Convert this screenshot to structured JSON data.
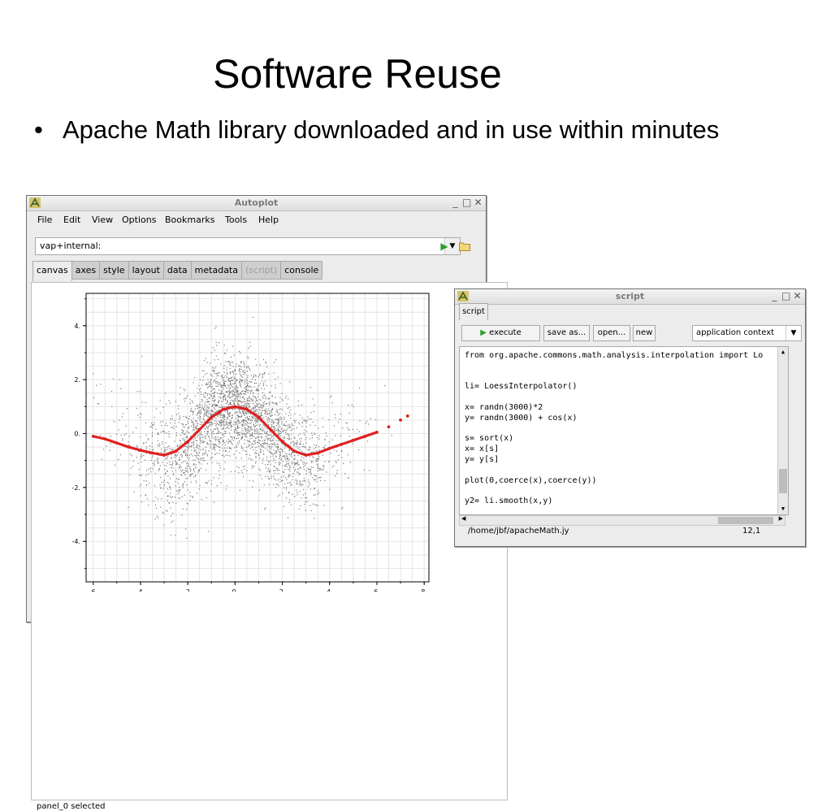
{
  "slide": {
    "title": "Software Reuse",
    "bullet_char": "•",
    "bullet_text": "Apache Math library downloaded and in use within minutes"
  },
  "autoplot": {
    "window_title": "Autoplot",
    "menu": [
      "File",
      "Edit",
      "View",
      "Options",
      "Bookmarks",
      "Tools",
      "Help"
    ],
    "url_value": "vap+internal:",
    "tabs": [
      {
        "label": "canvas",
        "active": true
      },
      {
        "label": "axes"
      },
      {
        "label": "style"
      },
      {
        "label": "layout"
      },
      {
        "label": "data"
      },
      {
        "label": "metadata"
      },
      {
        "label": "(script)",
        "disabled": true
      },
      {
        "label": "console"
      }
    ],
    "status": "panel_0 selected",
    "colors": {
      "smooth_curve": "#e02020",
      "scatter": "#555555",
      "play": "#2f9e2f",
      "folder": "#e8c04a"
    }
  },
  "chart_data": {
    "type": "scatter",
    "title": "",
    "xlabel": "",
    "ylabel": "",
    "xlim": [
      -6.3,
      8.2
    ],
    "ylim": [
      -5.5,
      5.2
    ],
    "x_ticks": [
      "-6.",
      "-4.",
      "-2.",
      "0.",
      "2.",
      "4.",
      "6.",
      "8."
    ],
    "y_ticks": [
      "4.",
      "2.",
      "0.",
      "-2.",
      "-4."
    ],
    "grid": true,
    "series": [
      {
        "description": "scatter points y = randn + cos(x), x = randn*2",
        "count": 3000
      },
      {
        "description": "loess smooth",
        "x": [
          -6.0,
          -5.5,
          -5.0,
          -4.5,
          -4.0,
          -3.5,
          -3.0,
          -2.5,
          -2.0,
          -1.5,
          -1.0,
          -0.5,
          0.0,
          0.5,
          1.0,
          1.5,
          2.0,
          2.5,
          3.0,
          3.5,
          4.0,
          4.5,
          5.0,
          5.5,
          6.0,
          6.5,
          7.0,
          7.3
        ],
        "y": [
          -0.1,
          -0.2,
          -0.35,
          -0.5,
          -0.62,
          -0.72,
          -0.8,
          -0.65,
          -0.3,
          0.15,
          0.6,
          0.9,
          1.0,
          0.9,
          0.6,
          0.15,
          -0.3,
          -0.65,
          -0.8,
          -0.72,
          -0.55,
          -0.4,
          -0.25,
          -0.1,
          0.05,
          0.25,
          0.5,
          0.65
        ]
      }
    ]
  },
  "script_window": {
    "window_title": "script",
    "tab": "script",
    "buttons": {
      "execute": "execute",
      "save_as": "save as...",
      "open": "open...",
      "new": "new"
    },
    "context": "application context",
    "code_lines": [
      "from org.apache.commons.math.analysis.interpolation import Lo",
      "",
      "",
      "li= LoessInterpolator()",
      "",
      "x= randn(3000)*2",
      "y= randn(3000) + cos(x)",
      "",
      "s= sort(x)",
      "x= x[s]",
      "y= y[s]",
      "",
      "plot(0,coerce(x),coerce(y))",
      "",
      "y2= li.smooth(x,y)"
    ],
    "status_path": "/home/jbf/apacheMath.jy",
    "cursor_pos": "12,1"
  }
}
